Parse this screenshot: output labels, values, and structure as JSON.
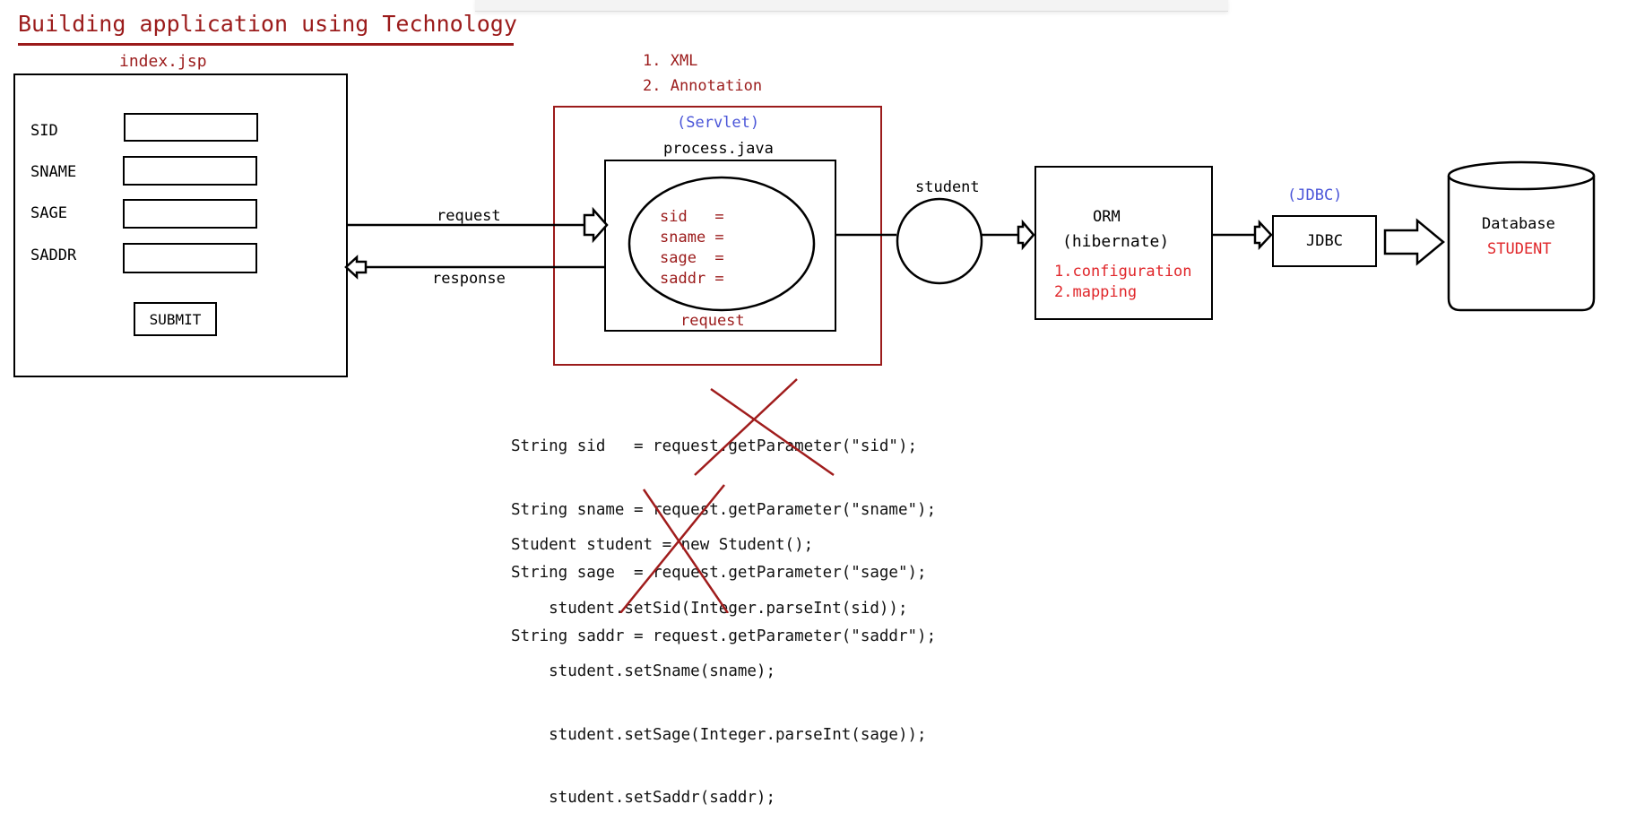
{
  "title": "Building application using Technology",
  "form": {
    "file_label": "index.jsp",
    "fields": [
      {
        "label": "SID",
        "value": ""
      },
      {
        "label": "SNAME",
        "value": ""
      },
      {
        "label": "SAGE",
        "value": ""
      },
      {
        "label": "SADDR",
        "value": ""
      }
    ],
    "submit_label": "SUBMIT"
  },
  "config_options": [
    "1. XML",
    "2. Annotation"
  ],
  "servlet": {
    "type_label": "(Servlet)",
    "file_label": "process.java",
    "vars": [
      "sid   =",
      "sname =",
      "sage  =",
      "saddr ="
    ],
    "inner_label": "request"
  },
  "arrows": {
    "request": "request",
    "response": "response",
    "student": "student"
  },
  "orm": {
    "line1": "ORM",
    "line2": "(hibernate)",
    "items": [
      "1.configuration",
      "2.mapping"
    ]
  },
  "jdbc": {
    "type_label": "(JDBC)",
    "label": "JDBC"
  },
  "database": {
    "label": "Database",
    "table": "STUDENT"
  },
  "code_lines_1": [
    "String sid   = request.getParameter(\"sid\");",
    "String sname = request.getParameter(\"sname\");",
    "String sage  = request.getParameter(\"sage\");",
    "String saddr = request.getParameter(\"saddr\");"
  ],
  "code_lines_2": [
    "Student student = new Student();",
    "    student.setSid(Integer.parseInt(sid));",
    "    student.setSname(sname);",
    "    student.setSage(Integer.parseInt(sage));",
    "    student.setSaddr(saddr);"
  ],
  "colors": {
    "dark_red": "#9b1b1b",
    "bright_red": "#e0262a",
    "blue": "#4a55d8",
    "cross": "#a01c1c"
  }
}
